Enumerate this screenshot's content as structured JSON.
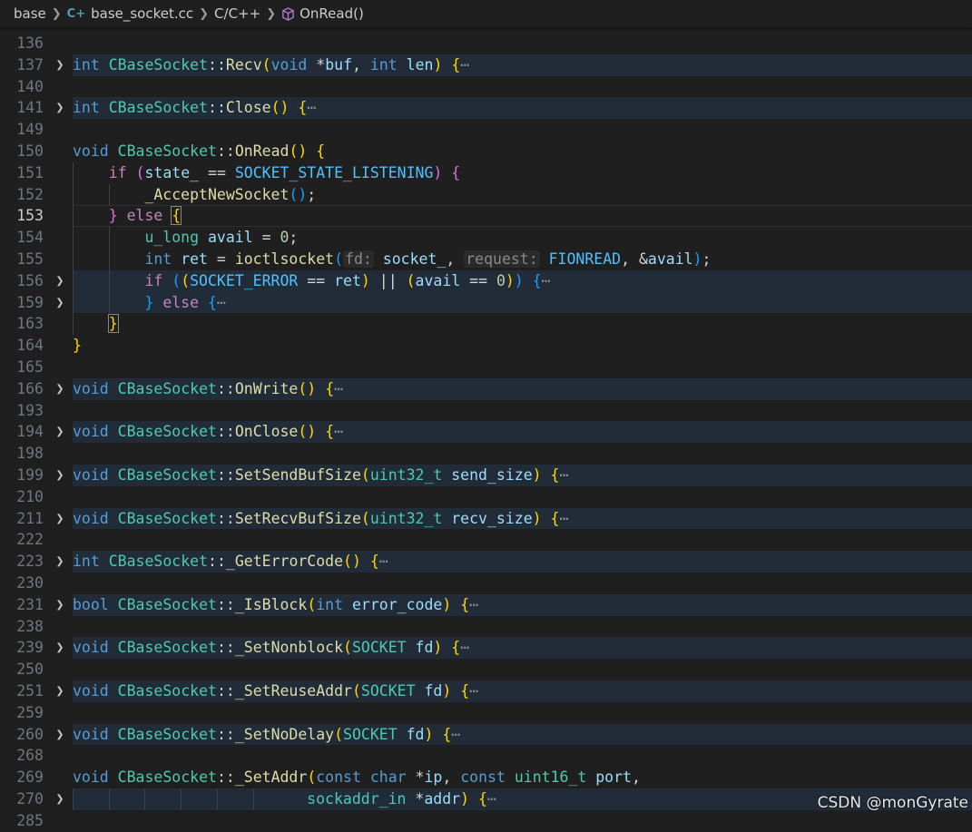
{
  "breadcrumb": {
    "folder": "base",
    "file": "base_socket.cc",
    "language": "C/C++",
    "symbol": "OnRead()",
    "file_icon": "cpp-icon",
    "symbol_icon": "cube-icon"
  },
  "watermark": "CSDN @monGyrate",
  "lines": [
    {
      "num": "136",
      "fold": false,
      "folded": false,
      "tokens": []
    },
    {
      "num": "137",
      "fold": true,
      "folded": true,
      "tokens": [
        [
          "keyword",
          "int "
        ],
        [
          "class",
          "CBaseSocket"
        ],
        [
          "plain",
          "::"
        ],
        [
          "function",
          "Recv"
        ],
        [
          "b1",
          "("
        ],
        [
          "keyword",
          "void "
        ],
        [
          "plain",
          "*"
        ],
        [
          "param",
          "buf"
        ],
        [
          "plain",
          ", "
        ],
        [
          "keyword",
          "int "
        ],
        [
          "param",
          "len"
        ],
        [
          "b1",
          ") "
        ],
        [
          "b1",
          "{"
        ],
        [
          "ellipsis",
          "⋯"
        ]
      ]
    },
    {
      "num": "140",
      "fold": false,
      "folded": false,
      "tokens": []
    },
    {
      "num": "141",
      "fold": true,
      "folded": true,
      "tokens": [
        [
          "keyword",
          "int "
        ],
        [
          "class",
          "CBaseSocket"
        ],
        [
          "plain",
          "::"
        ],
        [
          "function",
          "Close"
        ],
        [
          "b1",
          "() "
        ],
        [
          "b1",
          "{"
        ],
        [
          "ellipsis",
          "⋯"
        ]
      ]
    },
    {
      "num": "149",
      "fold": false,
      "folded": false,
      "tokens": []
    },
    {
      "num": "150",
      "fold": false,
      "folded": false,
      "tokens": [
        [
          "keyword",
          "void "
        ],
        [
          "class",
          "CBaseSocket"
        ],
        [
          "plain",
          "::"
        ],
        [
          "function",
          "OnRead"
        ],
        [
          "b1",
          "() "
        ],
        [
          "b1",
          "{"
        ]
      ]
    },
    {
      "num": "151",
      "fold": false,
      "folded": false,
      "indent": 1,
      "tokens": [
        [
          "control",
          "if "
        ],
        [
          "b2",
          "("
        ],
        [
          "variable",
          "state_"
        ],
        [
          "plain",
          " == "
        ],
        [
          "macro",
          "SOCKET_STATE_LISTENING"
        ],
        [
          "b2",
          ") "
        ],
        [
          "b2",
          "{"
        ]
      ]
    },
    {
      "num": "152",
      "fold": false,
      "folded": false,
      "indent": 2,
      "tokens": [
        [
          "function",
          "_AcceptNewSocket"
        ],
        [
          "b3",
          "()"
        ],
        [
          "plain",
          ";"
        ]
      ]
    },
    {
      "num": "153",
      "fold": false,
      "folded": false,
      "current": true,
      "indent": 1,
      "tokens": [
        [
          "b2",
          "} "
        ],
        [
          "control",
          "else "
        ],
        [
          "b2box",
          "{"
        ]
      ]
    },
    {
      "num": "154",
      "fold": false,
      "folded": false,
      "indent": 2,
      "tokens": [
        [
          "class",
          "u_long "
        ],
        [
          "variable",
          "avail"
        ],
        [
          "plain",
          " = "
        ],
        [
          "number",
          "0"
        ],
        [
          "plain",
          ";"
        ]
      ]
    },
    {
      "num": "155",
      "fold": false,
      "folded": false,
      "indent": 2,
      "tokens": [
        [
          "keyword",
          "int "
        ],
        [
          "variable",
          "ret"
        ],
        [
          "plain",
          " = "
        ],
        [
          "function",
          "ioctlsocket"
        ],
        [
          "b3",
          "("
        ],
        [
          "hint",
          "fd:"
        ],
        [
          "plain",
          " "
        ],
        [
          "variable",
          "socket_"
        ],
        [
          "plain",
          ", "
        ],
        [
          "hint",
          "request:"
        ],
        [
          "plain",
          " "
        ],
        [
          "macro",
          "FIONREAD"
        ],
        [
          "plain",
          ", &"
        ],
        [
          "variable",
          "avail"
        ],
        [
          "b3",
          ")"
        ],
        [
          "plain",
          ";"
        ]
      ]
    },
    {
      "num": "156",
      "fold": true,
      "folded": true,
      "indent": 2,
      "tokens": [
        [
          "control",
          "if "
        ],
        [
          "b3",
          "("
        ],
        [
          "b1",
          "("
        ],
        [
          "macro",
          "SOCKET_ERROR"
        ],
        [
          "plain",
          " == "
        ],
        [
          "variable",
          "ret"
        ],
        [
          "b1",
          ")"
        ],
        [
          "plain",
          " || "
        ],
        [
          "b1",
          "("
        ],
        [
          "variable",
          "avail"
        ],
        [
          "plain",
          " == "
        ],
        [
          "number",
          "0"
        ],
        [
          "b1",
          ")"
        ],
        [
          "b3",
          ") "
        ],
        [
          "b3",
          "{"
        ],
        [
          "ellipsis",
          "⋯"
        ]
      ]
    },
    {
      "num": "159",
      "fold": true,
      "folded": true,
      "indent": 2,
      "tokens": [
        [
          "b3",
          "} "
        ],
        [
          "control",
          "else "
        ],
        [
          "b3",
          "{"
        ],
        [
          "ellipsis",
          "⋯"
        ]
      ]
    },
    {
      "num": "163",
      "fold": false,
      "folded": false,
      "indent": 1,
      "tokens": [
        [
          "b2box",
          "}"
        ]
      ]
    },
    {
      "num": "164",
      "fold": false,
      "folded": false,
      "tokens": [
        [
          "b1",
          "}"
        ]
      ]
    },
    {
      "num": "165",
      "fold": false,
      "folded": false,
      "tokens": []
    },
    {
      "num": "166",
      "fold": true,
      "folded": true,
      "tokens": [
        [
          "keyword",
          "void "
        ],
        [
          "class",
          "CBaseSocket"
        ],
        [
          "plain",
          "::"
        ],
        [
          "function",
          "OnWrite"
        ],
        [
          "b1",
          "() "
        ],
        [
          "b1",
          "{"
        ],
        [
          "ellipsis",
          "⋯"
        ]
      ]
    },
    {
      "num": "193",
      "fold": false,
      "folded": false,
      "tokens": []
    },
    {
      "num": "194",
      "fold": true,
      "folded": true,
      "tokens": [
        [
          "keyword",
          "void "
        ],
        [
          "class",
          "CBaseSocket"
        ],
        [
          "plain",
          "::"
        ],
        [
          "function",
          "OnClose"
        ],
        [
          "b1",
          "() "
        ],
        [
          "b1",
          "{"
        ],
        [
          "ellipsis",
          "⋯"
        ]
      ]
    },
    {
      "num": "198",
      "fold": false,
      "folded": false,
      "tokens": []
    },
    {
      "num": "199",
      "fold": true,
      "folded": true,
      "tokens": [
        [
          "keyword",
          "void "
        ],
        [
          "class",
          "CBaseSocket"
        ],
        [
          "plain",
          "::"
        ],
        [
          "function",
          "SetSendBufSize"
        ],
        [
          "b1",
          "("
        ],
        [
          "class",
          "uint32_t "
        ],
        [
          "param",
          "send_size"
        ],
        [
          "b1",
          ") "
        ],
        [
          "b1",
          "{"
        ],
        [
          "ellipsis",
          "⋯"
        ]
      ]
    },
    {
      "num": "210",
      "fold": false,
      "folded": false,
      "tokens": []
    },
    {
      "num": "211",
      "fold": true,
      "folded": true,
      "tokens": [
        [
          "keyword",
          "void "
        ],
        [
          "class",
          "CBaseSocket"
        ],
        [
          "plain",
          "::"
        ],
        [
          "function",
          "SetRecvBufSize"
        ],
        [
          "b1",
          "("
        ],
        [
          "class",
          "uint32_t "
        ],
        [
          "param",
          "recv_size"
        ],
        [
          "b1",
          ") "
        ],
        [
          "b1",
          "{"
        ],
        [
          "ellipsis",
          "⋯"
        ]
      ]
    },
    {
      "num": "222",
      "fold": false,
      "folded": false,
      "tokens": []
    },
    {
      "num": "223",
      "fold": true,
      "folded": true,
      "tokens": [
        [
          "keyword",
          "int "
        ],
        [
          "class",
          "CBaseSocket"
        ],
        [
          "plain",
          "::"
        ],
        [
          "function",
          "_GetErrorCode"
        ],
        [
          "b1",
          "() "
        ],
        [
          "b1",
          "{"
        ],
        [
          "ellipsis",
          "⋯"
        ]
      ]
    },
    {
      "num": "230",
      "fold": false,
      "folded": false,
      "tokens": []
    },
    {
      "num": "231",
      "fold": true,
      "folded": true,
      "tokens": [
        [
          "keyword",
          "bool "
        ],
        [
          "class",
          "CBaseSocket"
        ],
        [
          "plain",
          "::"
        ],
        [
          "function",
          "_IsBlock"
        ],
        [
          "b1",
          "("
        ],
        [
          "keyword",
          "int "
        ],
        [
          "param",
          "error_code"
        ],
        [
          "b1",
          ") "
        ],
        [
          "b1",
          "{"
        ],
        [
          "ellipsis",
          "⋯"
        ]
      ]
    },
    {
      "num": "238",
      "fold": false,
      "folded": false,
      "tokens": []
    },
    {
      "num": "239",
      "fold": true,
      "folded": true,
      "tokens": [
        [
          "keyword",
          "void "
        ],
        [
          "class",
          "CBaseSocket"
        ],
        [
          "plain",
          "::"
        ],
        [
          "function",
          "_SetNonblock"
        ],
        [
          "b1",
          "("
        ],
        [
          "class",
          "SOCKET "
        ],
        [
          "param",
          "fd"
        ],
        [
          "b1",
          ") "
        ],
        [
          "b1",
          "{"
        ],
        [
          "ellipsis",
          "⋯"
        ]
      ]
    },
    {
      "num": "250",
      "fold": false,
      "folded": false,
      "tokens": []
    },
    {
      "num": "251",
      "fold": true,
      "folded": true,
      "tokens": [
        [
          "keyword",
          "void "
        ],
        [
          "class",
          "CBaseSocket"
        ],
        [
          "plain",
          "::"
        ],
        [
          "function",
          "_SetReuseAddr"
        ],
        [
          "b1",
          "("
        ],
        [
          "class",
          "SOCKET "
        ],
        [
          "param",
          "fd"
        ],
        [
          "b1",
          ") "
        ],
        [
          "b1",
          "{"
        ],
        [
          "ellipsis",
          "⋯"
        ]
      ]
    },
    {
      "num": "259",
      "fold": false,
      "folded": false,
      "tokens": []
    },
    {
      "num": "260",
      "fold": true,
      "folded": true,
      "tokens": [
        [
          "keyword",
          "void "
        ],
        [
          "class",
          "CBaseSocket"
        ],
        [
          "plain",
          "::"
        ],
        [
          "function",
          "_SetNoDelay"
        ],
        [
          "b1",
          "("
        ],
        [
          "class",
          "SOCKET "
        ],
        [
          "param",
          "fd"
        ],
        [
          "b1",
          ") "
        ],
        [
          "b1",
          "{"
        ],
        [
          "ellipsis",
          "⋯"
        ]
      ]
    },
    {
      "num": "268",
      "fold": false,
      "folded": false,
      "tokens": []
    },
    {
      "num": "269",
      "fold": false,
      "folded": false,
      "tokens": [
        [
          "keyword",
          "void "
        ],
        [
          "class",
          "CBaseSocket"
        ],
        [
          "plain",
          "::"
        ],
        [
          "function",
          "_SetAddr"
        ],
        [
          "b1",
          "("
        ],
        [
          "keyword",
          "const char "
        ],
        [
          "plain",
          "*"
        ],
        [
          "param",
          "ip"
        ],
        [
          "plain",
          ", "
        ],
        [
          "keyword",
          "const "
        ],
        [
          "class",
          "uint16_t "
        ],
        [
          "param",
          "port"
        ],
        [
          "plain",
          ","
        ]
      ]
    },
    {
      "num": "270",
      "fold": true,
      "folded": true,
      "indent": 6,
      "pad": 2,
      "tokens": [
        [
          "class",
          "sockaddr_in "
        ],
        [
          "plain",
          "*"
        ],
        [
          "param",
          "addr"
        ],
        [
          "b1",
          ") "
        ],
        [
          "b1",
          "{"
        ],
        [
          "ellipsis",
          "⋯"
        ]
      ]
    },
    {
      "num": "285",
      "fold": false,
      "folded": false,
      "tokens": []
    }
  ]
}
